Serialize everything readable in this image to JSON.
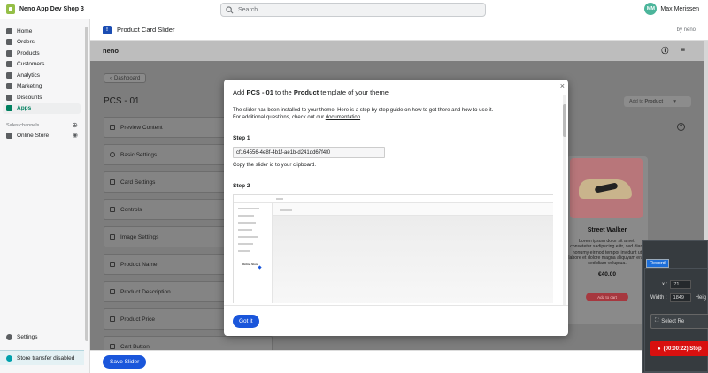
{
  "topbar": {
    "store_name": "Neno App Dev Shop 3",
    "search_placeholder": "Search",
    "user_initials": "MM",
    "user_name": "Max Merissen"
  },
  "sidebar": {
    "items": [
      {
        "label": "Home",
        "icon": "home-icon"
      },
      {
        "label": "Orders",
        "icon": "orders-icon"
      },
      {
        "label": "Products",
        "icon": "tag-icon"
      },
      {
        "label": "Customers",
        "icon": "person-icon"
      },
      {
        "label": "Analytics",
        "icon": "chart-icon"
      },
      {
        "label": "Marketing",
        "icon": "target-icon"
      },
      {
        "label": "Discounts",
        "icon": "discount-icon"
      },
      {
        "label": "Apps",
        "icon": "apps-icon",
        "active": true
      }
    ],
    "sales_channels_label": "Sales channels",
    "online_store_label": "Online Store",
    "settings_label": "Settings",
    "toast_label": "Store transfer disabled"
  },
  "app": {
    "title": "Product Card Slider",
    "by": "by neno",
    "brand": "neno",
    "back_label": "Dashboard",
    "page_title": "PCS - 01",
    "add_to_label": "Add to",
    "add_to_target": "Product",
    "save_label": "Save Slider",
    "settings_items": [
      "Preview Content",
      "Basic Settings",
      "Card Settings",
      "Controls",
      "Image Settings",
      "Product Name",
      "Product Description",
      "Product Price",
      "Cart Button"
    ],
    "card": {
      "title": "Street Walker",
      "description": "Lorem ipsum dolor sit amet, consetetur sadipscing elitr, sed diam nonumy eirmod tempor invidunt ut labore et dolore magna aliquyam erat, sed diam voluptua.",
      "price": "€40.00",
      "button": "Add to cart"
    }
  },
  "modal": {
    "title_prefix": "Add ",
    "title_slider": "PCS - 01",
    "title_middle": " to the ",
    "title_template": "Product",
    "title_suffix": " template of your theme",
    "intro_line1": "The slider has been installed to your theme. Here is a step by step guide on how to get there and how to use it.",
    "intro_line2": "For additional questions, check out our ",
    "doc_link": "documentation",
    "intro_end": ".",
    "step1_label": "Step 1",
    "slider_id": "cf164556-4e8f-4b1f-ae1b-d241dd67f4f0",
    "step1_caption": "Copy the slider id to your clipboard.",
    "step2_label": "Step 2",
    "screenshot_label": "Online Store",
    "got_it_label": "Got it",
    "close_glyph": "×"
  },
  "recorder": {
    "tab_label": "Record",
    "x_label": "x :",
    "x_value": "71",
    "width_label": "Width :",
    "width_value": "1849",
    "height_label": "Heig",
    "select_label": "Select Re",
    "stop_label": "(00:00:22) Stop"
  }
}
